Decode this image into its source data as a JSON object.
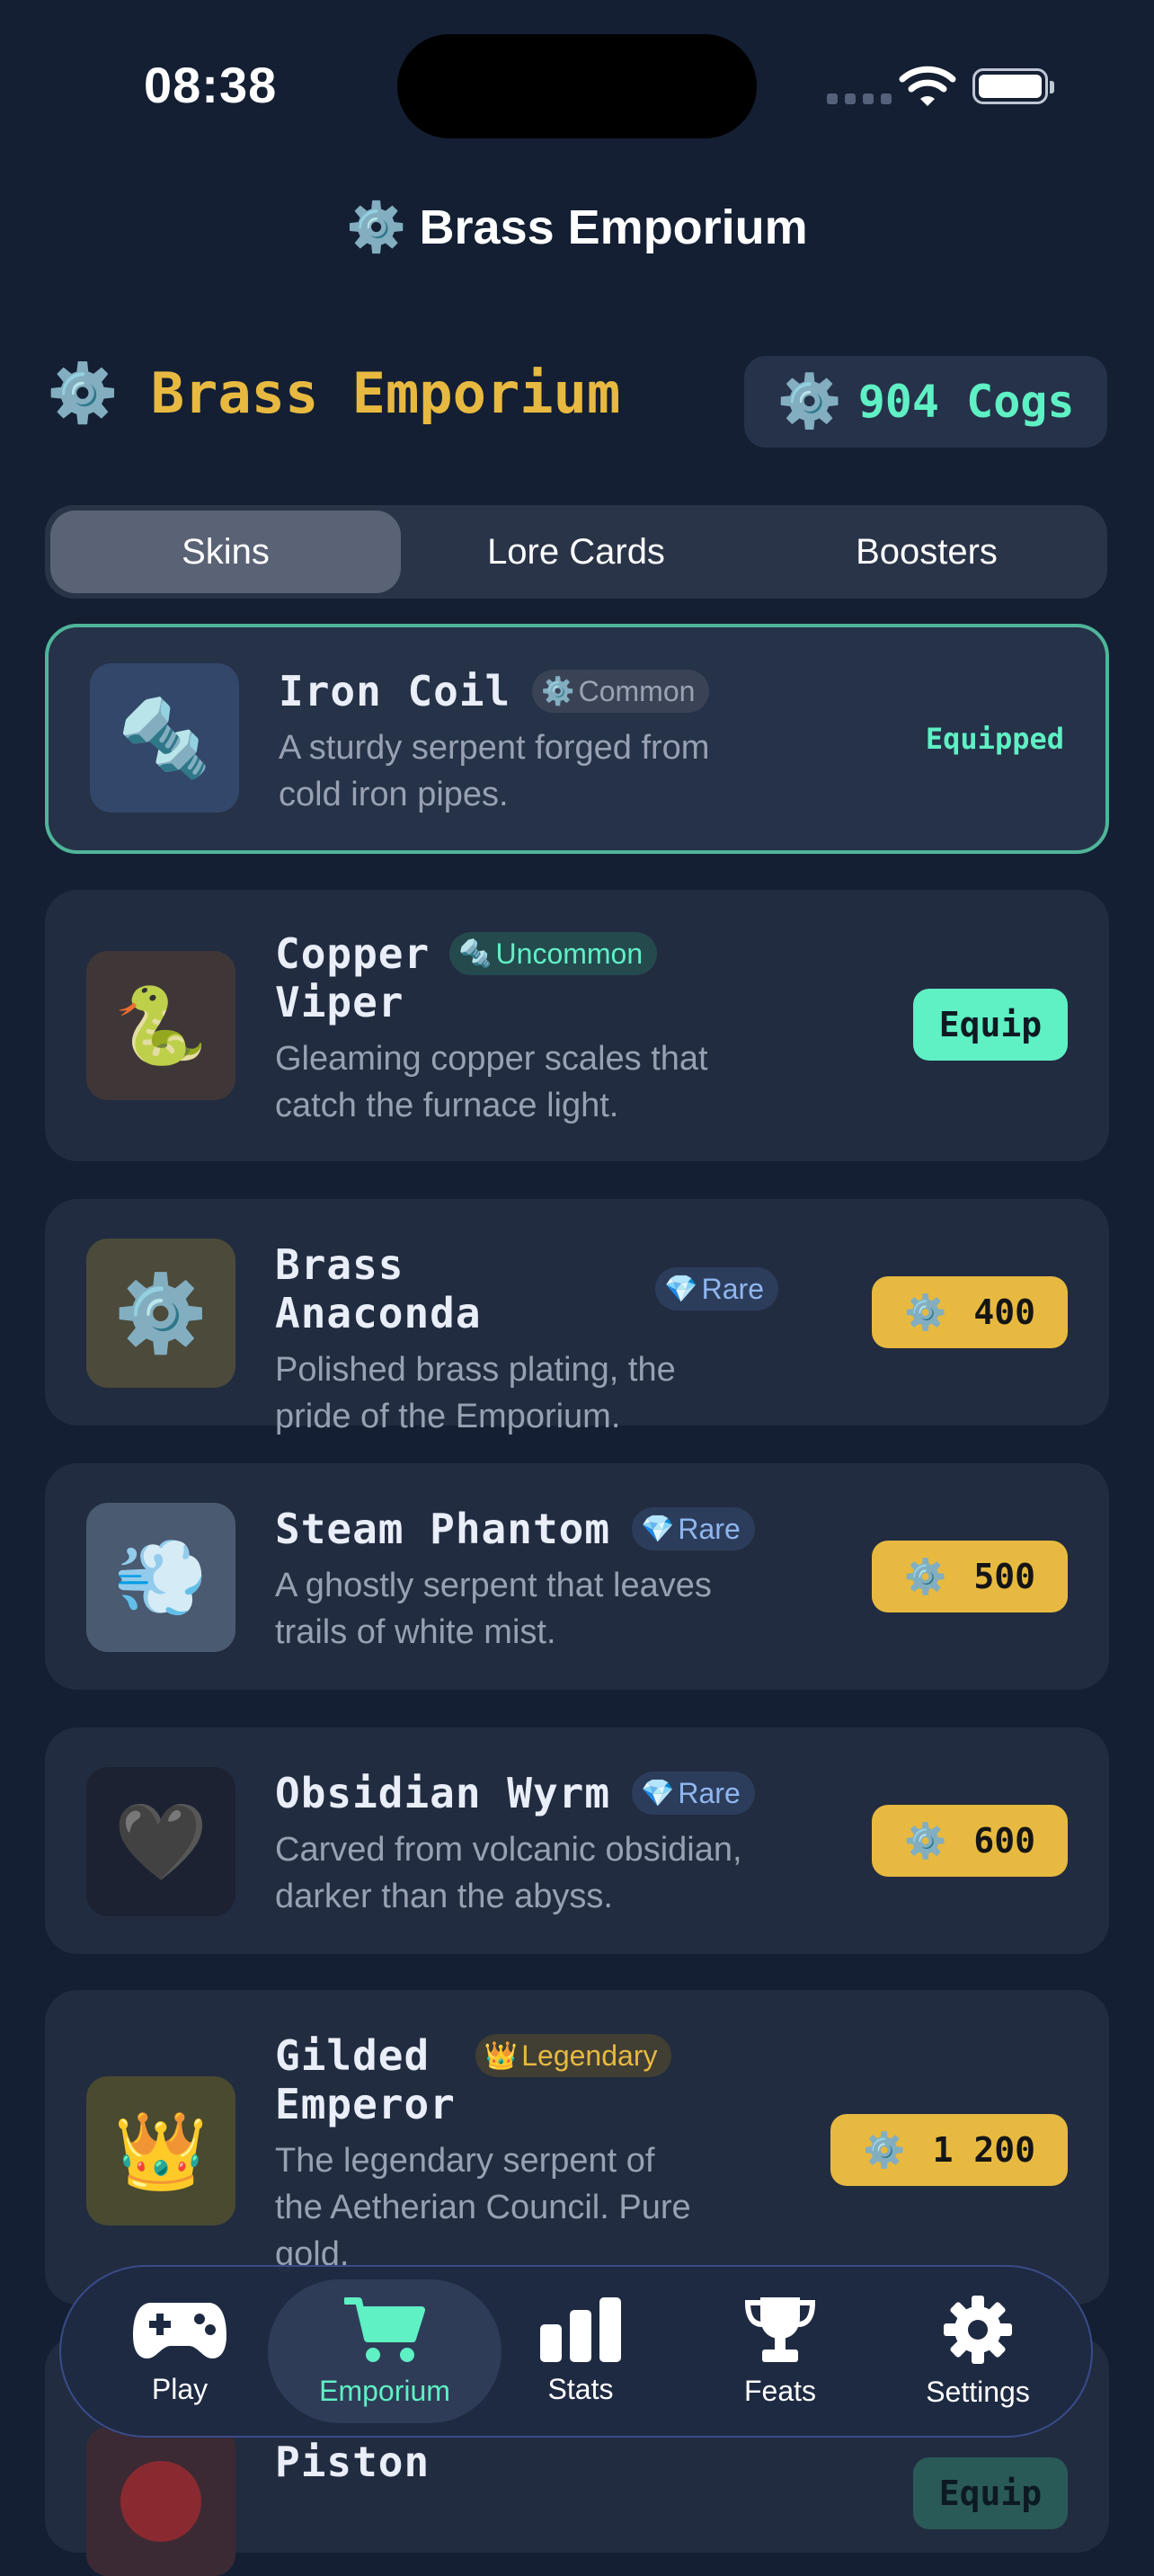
{
  "status": {
    "time": "08:38"
  },
  "nav": {
    "title": "Brass Emporium",
    "icon": "gear-icon"
  },
  "header": {
    "brand_icon": "gear-icon",
    "brand_name": "Brass Emporium",
    "balance": "904 Cogs",
    "balance_icon": "gear-icon"
  },
  "tabs": [
    "Skins",
    "Lore Cards",
    "Boosters"
  ],
  "active_tab": "Skins",
  "items": [
    {
      "name": "Iron Coil",
      "rarity": "Common",
      "rarity_icon": "⚙️",
      "desc1": "A sturdy serpent forged from",
      "desc2": "cold iron pipes.",
      "thumb": "🔩",
      "action": "Equipped",
      "state": "equipped"
    },
    {
      "name1": "Copper",
      "name2": "Viper",
      "rarity": "Uncommon",
      "rarity_icon": "🔩",
      "desc1": "Gleaming copper scales that",
      "desc2": "catch the furnace light.",
      "thumb": "🐍",
      "action": "Equip",
      "state": "owned"
    },
    {
      "name": "Brass Anaconda",
      "rarity": "Rare",
      "rarity_icon": "💎",
      "desc1": "Polished brass plating, the",
      "desc2": "pride of the Emporium.",
      "thumb": "⚙️",
      "price": "400",
      "state": "buy"
    },
    {
      "name": "Steam Phantom",
      "rarity": "Rare",
      "rarity_icon": "💎",
      "desc1": "A ghostly serpent that leaves",
      "desc2": "trails of white mist.",
      "thumb": "💨",
      "price": "500",
      "state": "buy"
    },
    {
      "name": "Obsidian Wyrm",
      "rarity": "Rare",
      "rarity_icon": "💎",
      "desc1": "Carved from volcanic obsidian,",
      "desc2": "darker than the abyss.",
      "thumb": "🖤",
      "price": "600",
      "state": "buy"
    },
    {
      "name1": "Gilded",
      "name2": "Emperor",
      "rarity": "Legendary",
      "rarity_icon": "👑",
      "desc1": "The legendary serpent of",
      "desc2": "the Aetherian Council. Pure",
      "desc3": "gold.",
      "thumb": "👑",
      "price": "1 200",
      "state": "buy"
    },
    {
      "name2": "Piston",
      "action": "Equip"
    }
  ],
  "tabbar": [
    {
      "label": "Play",
      "icon": "gamepad-icon"
    },
    {
      "label": "Emporium",
      "icon": "cart-icon",
      "active": true
    },
    {
      "label": "Stats",
      "icon": "bar-chart-icon"
    },
    {
      "label": "Feats",
      "icon": "trophy-icon"
    },
    {
      "label": "Settings",
      "icon": "settings-gear-icon"
    }
  ],
  "colors": {
    "accent": "#5ff0c4",
    "brass": "#e7b940",
    "background": "#141f33",
    "card": "#222c40"
  }
}
